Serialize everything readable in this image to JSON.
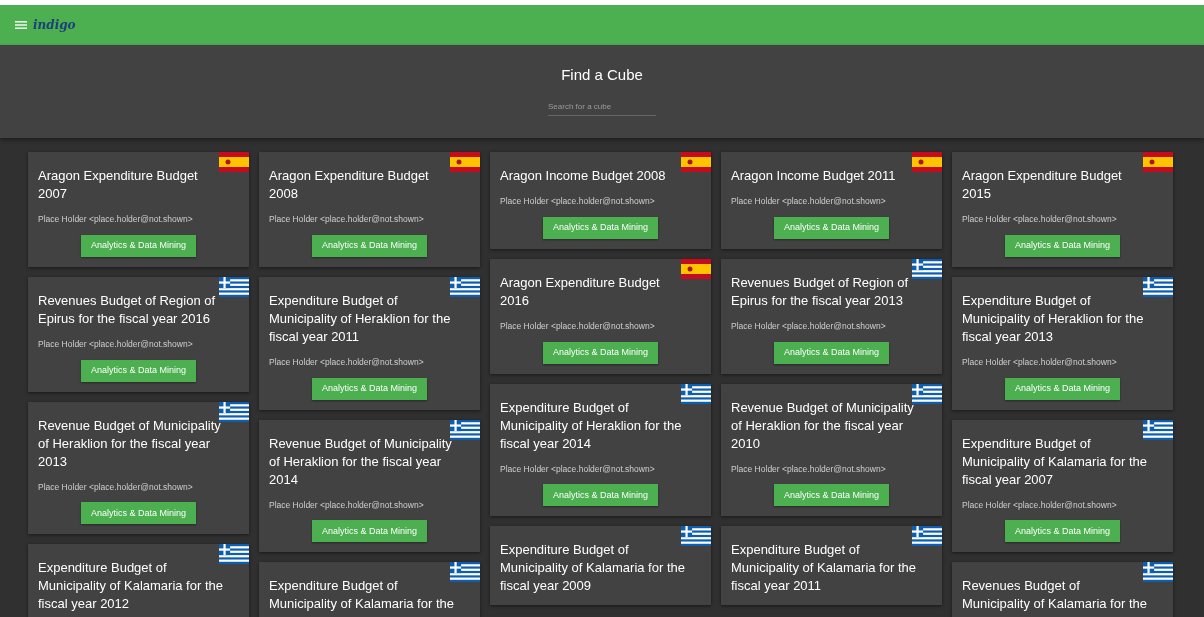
{
  "app_bar": {
    "logo": "indigo"
  },
  "header": {
    "title": "Find a Cube",
    "search": {
      "placeholder": "Search for a cube"
    }
  },
  "columns": [
    {
      "cards": [
        {
          "title": "Aragon Expenditure Budget 2007",
          "kind": "spain",
          "author": "Place Holder <place.holder@not.shown>",
          "button": "Analytics & Data Mining"
        },
        {
          "title": "Revenues Budget of Region of Epirus for the fiscal year 2016",
          "kind": "greece",
          "author": "Place Holder <place.holder@not.shown>",
          "button": "Analytics & Data Mining"
        },
        {
          "title": "Revenue Budget of Municipality of Heraklion for the fiscal year 2013",
          "kind": "greece",
          "author": "Place Holder <place.holder@not.shown>",
          "button": "Analytics & Data Mining"
        },
        {
          "title": "Expenditure Budget of Municipality of Kalamaria for the fiscal year 2012",
          "kind": "greece"
        }
      ]
    },
    {
      "cards": [
        {
          "title": "Aragon Expenditure Budget 2008",
          "kind": "spain",
          "author": "Place Holder <place.holder@not.shown>",
          "button": "Analytics & Data Mining"
        },
        {
          "title": "Expenditure Budget of Municipality of Heraklion for the fiscal year 2011",
          "kind": "greece",
          "author": "Place Holder <place.holder@not.shown>",
          "button": "Analytics & Data Mining"
        },
        {
          "title": "Revenue Budget of Municipality of Heraklion for the fiscal year 2014",
          "kind": "greece",
          "author": "Place Holder <place.holder@not.shown>",
          "button": "Analytics & Data Mining"
        },
        {
          "title": "Expenditure Budget of Municipality of Kalamaria for the",
          "kind": "greece"
        }
      ]
    },
    {
      "cards": [
        {
          "title": "Aragon Income Budget 2008",
          "kind": "spain",
          "author": "Place Holder <place.holder@not.shown>",
          "button": "Analytics & Data Mining"
        },
        {
          "title": "Aragon Expenditure Budget 2016",
          "kind": "spain",
          "author": "Place Holder <place.holder@not.shown>",
          "button": "Analytics & Data Mining"
        },
        {
          "title": "Expenditure Budget of Municipality of Heraklion for the fiscal year 2014",
          "kind": "greece",
          "author": "Place Holder <place.holder@not.shown>",
          "button": "Analytics & Data Mining"
        },
        {
          "title": "Expenditure Budget of Municipality of Kalamaria for the fiscal year 2009",
          "kind": "greece"
        }
      ]
    },
    {
      "cards": [
        {
          "title": "Aragon Income Budget 2011",
          "kind": "spain",
          "author": "Place Holder <place.holder@not.shown>",
          "button": "Analytics & Data Mining"
        },
        {
          "title": "Revenues Budget of Region of Epirus for the fiscal year 2013",
          "kind": "greece",
          "author": "Place Holder <place.holder@not.shown>",
          "button": "Analytics & Data Mining"
        },
        {
          "title": "Revenue Budget of Municipality of Heraklion for the fiscal year 2010",
          "kind": "greece",
          "author": "Place Holder <place.holder@not.shown>",
          "button": "Analytics & Data Mining"
        },
        {
          "title": "Expenditure Budget of Municipality of Kalamaria for the fiscal year 2011",
          "kind": "greece"
        }
      ]
    },
    {
      "cards": [
        {
          "title": "Aragon Expenditure Budget 2015",
          "kind": "spain",
          "author": "Place Holder <place.holder@not.shown>",
          "button": "Analytics & Data Mining"
        },
        {
          "title": "Expenditure Budget of Municipality of Heraklion for the fiscal year 2013",
          "kind": "greece",
          "author": "Place Holder <place.holder@not.shown>",
          "button": "Analytics & Data Mining"
        },
        {
          "title": "Expenditure Budget of Municipality of Kalamaria for the fiscal year 2007",
          "kind": "greece",
          "author": "Place Holder <place.holder@not.shown>",
          "button": "Analytics & Data Mining"
        },
        {
          "title": "Revenues Budget of Municipality of Kalamaria for the",
          "kind": "greece"
        }
      ]
    }
  ]
}
